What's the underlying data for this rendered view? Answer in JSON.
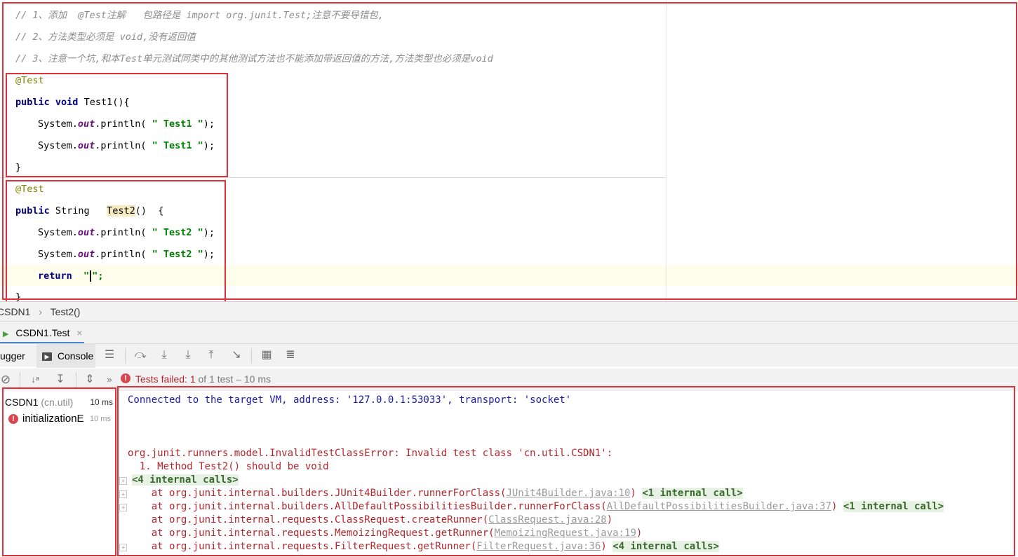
{
  "editor": {
    "comments": [
      "// 1、添加  @Test注解   包路径是 import org.junit.Test;注意不要导错包,",
      "// 2、方法类型必须是 void,没有返回值",
      "// 3、注意一个坑,和本Test单元测试同类中的其他测试方法也不能添加带返回值的方法,方法类型也必须是void"
    ],
    "method1": {
      "annotation": "@Test",
      "kw_public": "public",
      "kw_void": "void",
      "signature": "Test1(){",
      "print_prefix": "System.",
      "print_field": "out",
      "print_call": ".println( ",
      "print_str": "\" Test1 \"",
      "print_end": ");",
      "close": "}"
    },
    "method2": {
      "annotation": "@Test",
      "kw_public": "public",
      "return_type": "String",
      "name": "Test2",
      "signature_rest": "()  {",
      "print_prefix": "System.",
      "print_field": "out",
      "print_call": ".println( ",
      "print_str": "\" Test2 \"",
      "print_end": ");",
      "kw_return": "return",
      "return_open": "\"",
      "return_close": "\";",
      "close": "}"
    }
  },
  "breadcrumb": {
    "class": "CSDN1",
    "separator": "›",
    "method": "Test2()"
  },
  "run_tab": {
    "label": "CSDN1.Test",
    "close": "×"
  },
  "tabs": {
    "debugger": "ugger",
    "console": "Console"
  },
  "status": {
    "prefix": "Tests failed: ",
    "failed": "1",
    "rest": " of 1 test – 10 ms"
  },
  "tree": {
    "items": [
      {
        "name": "CSDN1",
        "package": " (cn.util)",
        "time": "10 ms"
      },
      {
        "name": "initializationE",
        "time": "10 ms"
      }
    ]
  },
  "console": {
    "connected": "Connected to the target VM, address: '127.0.0.1:53033', transport: 'socket'",
    "error_line": "org.junit.runners.model.InvalidTestClassError: Invalid test class 'cn.util.CSDN1':",
    "error_detail": "  1. Method Test2() should be void",
    "internal_calls_4": "<4 internal calls>",
    "stack": [
      {
        "text": "    at org.junit.internal.builders.JUnit4Builder.runnerForClass(",
        "link": "JUnit4Builder.java:10",
        "end": ")",
        "fold": "<1 internal call>"
      },
      {
        "text": "    at org.junit.internal.builders.AllDefaultPossibilitiesBuilder.runnerForClass(",
        "link": "AllDefaultPossibilitiesBuilder.java:37",
        "end": ")",
        "fold": "<1 internal call>"
      },
      {
        "text": "    at org.junit.internal.requests.ClassRequest.createRunner(",
        "link": "ClassRequest.java:28",
        "end": ")",
        "fold": ""
      },
      {
        "text": "    at org.junit.internal.requests.MemoizingRequest.getRunner(",
        "link": "MemoizingRequest.java:19",
        "end": ")",
        "fold": ""
      },
      {
        "text": "    at org.junit.internal.requests.FilterRequest.getRunner(",
        "link": "FilterRequest.java:36",
        "end": ")",
        "fold": "<4 internal calls>"
      }
    ]
  },
  "colors": {
    "highlight_border": "#e0303a",
    "error_text": "#b3262b",
    "info_text": "#1a1aa6"
  }
}
